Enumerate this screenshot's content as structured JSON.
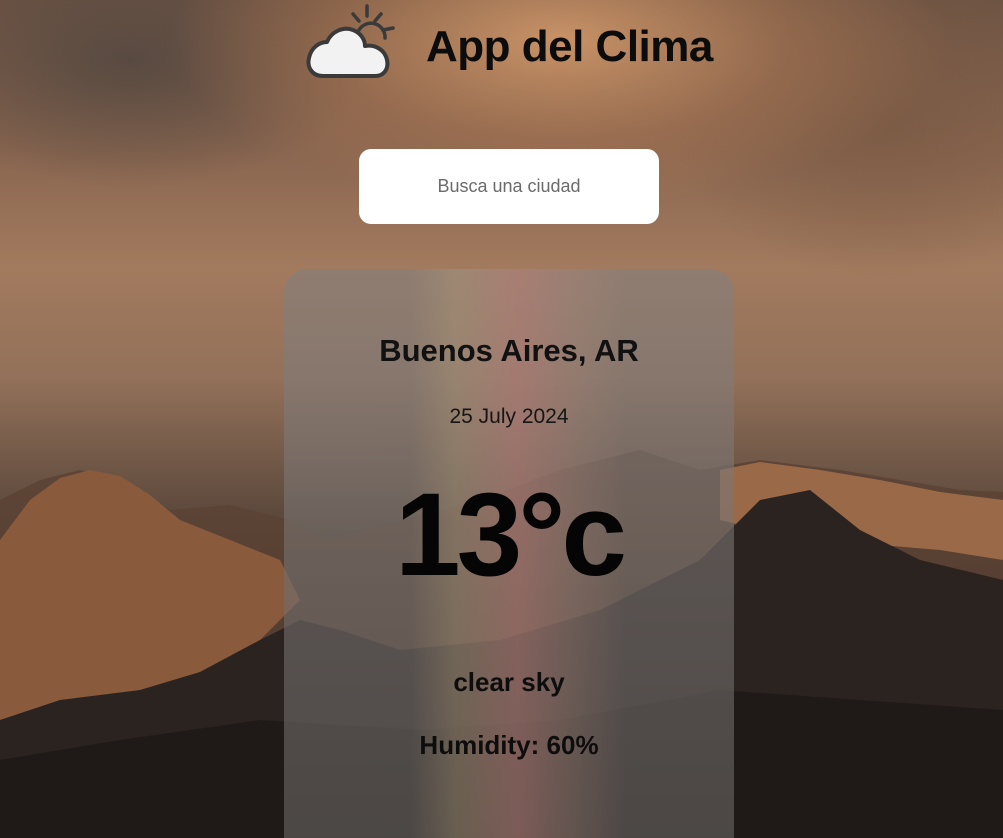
{
  "header": {
    "title": "App del Clima",
    "logo_icon": "cloud-sun-icon"
  },
  "search": {
    "placeholder": "Busca una ciudad",
    "value": ""
  },
  "weather": {
    "city": "Buenos Aires, AR",
    "date": "25 July 2024",
    "temperature": "13°c",
    "description": "clear sky",
    "humidity": "Humidity: 60%"
  },
  "colors": {
    "title_text": "#0c0c0c",
    "search_background": "#ffffff",
    "logo_stroke": "#3a3a3a"
  }
}
